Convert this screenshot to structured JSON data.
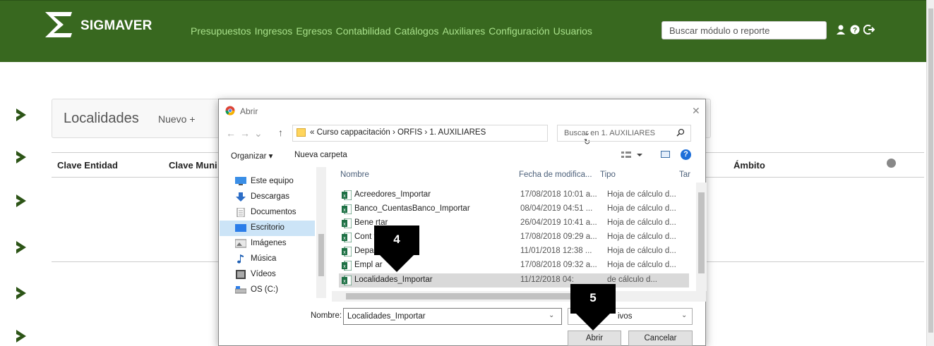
{
  "app": {
    "brand": "SIGMAVER",
    "nav": [
      "Presupuestos",
      "Ingresos",
      "Egresos",
      "Contabilidad",
      "Catálogos",
      "Auxiliares",
      "Configuración",
      "Usuarios"
    ],
    "search_placeholder": "Buscar módulo o reporte",
    "icons": [
      "user-icon",
      "help-icon",
      "logout-icon"
    ],
    "accent": "#38681f"
  },
  "page": {
    "title": "Localidades",
    "new_label": "Nuevo +",
    "columns": [
      "Clave Entidad",
      "Clave Muni",
      "Ámbito"
    ]
  },
  "dialog": {
    "title": "Abrir",
    "path": "« Curso cappacitación › ORFIS › 1. AUXILIARES",
    "search_placeholder": "Buscar en 1. AUXILIARES",
    "organize": "Organizar ▾",
    "new_folder": "Nueva carpeta",
    "nav_items": [
      {
        "label": "Este equipo",
        "icon": "computer-icon"
      },
      {
        "label": "Descargas",
        "icon": "download-icon"
      },
      {
        "label": "Documentos",
        "icon": "document-icon"
      },
      {
        "label": "Escritorio",
        "icon": "desktop-icon"
      },
      {
        "label": "Imágenes",
        "icon": "image-icon"
      },
      {
        "label": "Música",
        "icon": "music-icon"
      },
      {
        "label": "Vídeos",
        "icon": "video-icon"
      },
      {
        "label": "OS (C:)",
        "icon": "drive-icon"
      }
    ],
    "headers": {
      "name": "Nombre",
      "date": "Fecha de modifica...",
      "type": "Tipo",
      "size": "Tar"
    },
    "files": [
      {
        "name": "Acreedores_Importar",
        "date": "17/08/2018 10:01 a...",
        "type": "Hoja de cálculo d..."
      },
      {
        "name": "Banco_CuentasBanco_Importar",
        "date": "08/04/2019 04:51 ...",
        "type": "Hoja de cálculo d..."
      },
      {
        "name": "Bene        rtar",
        "date": "26/04/2019 10:41 a...",
        "type": "Hoja de cálculo d..."
      },
      {
        "name": "Cont              tar",
        "date": "17/08/2018 09:29 a...",
        "type": "Hoja de cálculo d..."
      },
      {
        "name": "Depa              portar",
        "date": "11/01/2018 12:38 ...",
        "type": "Hoja de cálculo d..."
      },
      {
        "name": "Empl              ar",
        "date": "17/08/2018 09:32 a...",
        "type": "Hoja de cálculo d..."
      },
      {
        "name": "Localidades_Importar",
        "date": "11/12/2018 04:   ",
        "type": "  de cálculo d..."
      }
    ],
    "filename_label": "Nombre:",
    "filename_value": "Localidades_Importar",
    "filetype_value": "ivos",
    "open_button": "Abrir",
    "cancel_button": "Cancelar"
  },
  "callouts": [
    {
      "number": "4"
    },
    {
      "number": "5"
    }
  ]
}
